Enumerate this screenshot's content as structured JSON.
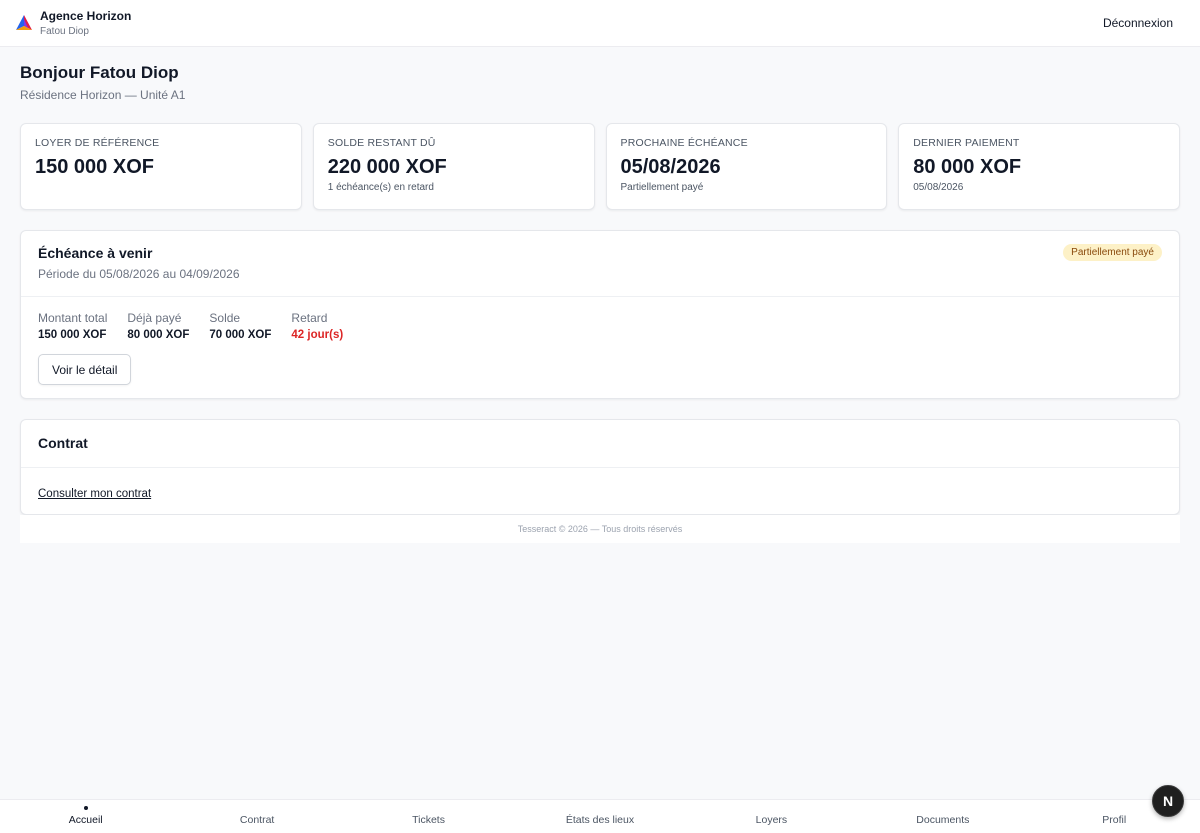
{
  "header": {
    "brand_name": "Agence Horizon",
    "user_name": "Fatou Diop",
    "logout_label": "Déconnexion"
  },
  "greeting": {
    "title": "Bonjour Fatou Diop",
    "residence": "Résidence Horizon — Unité A1"
  },
  "stats": [
    {
      "label": "LOYER DE RÉFÉRENCE",
      "value": "150 000 XOF",
      "sub": ""
    },
    {
      "label": "SOLDE RESTANT DÛ",
      "value": "220 000 XOF",
      "sub": "1 échéance(s) en retard"
    },
    {
      "label": "PROCHAINE ÉCHÉANCE",
      "value": "05/08/2026",
      "sub": "Partiellement payé"
    },
    {
      "label": "DERNIER PAIEMENT",
      "value": "80 000 XOF",
      "sub": "05/08/2026"
    }
  ],
  "due": {
    "title": "Échéance à venir",
    "period": "Période du 05/08/2026 au 04/09/2026",
    "status_badge": "Partiellement payé",
    "amounts": [
      {
        "label": "Montant total",
        "value": "150 000 XOF"
      },
      {
        "label": "Déjà payé",
        "value": "80 000 XOF"
      },
      {
        "label": "Solde",
        "value": "70 000 XOF"
      },
      {
        "label": "Retard",
        "value": "42 jour(s)"
      }
    ],
    "detail_button": "Voir le détail"
  },
  "contract": {
    "title": "Contrat",
    "link_label": "Consulter mon contrat"
  },
  "footer": {
    "text": "Tesseract © 2026 — Tous droits réservés"
  },
  "bottom_nav": {
    "items": [
      {
        "label": "Accueil"
      },
      {
        "label": "Contrat"
      },
      {
        "label": "Tickets"
      },
      {
        "label": "États des lieux"
      },
      {
        "label": "Loyers"
      },
      {
        "label": "Documents"
      },
      {
        "label": "Profil"
      }
    ],
    "active_index": 0
  },
  "dev_badge": {
    "letter": "N"
  },
  "colors": {
    "late_text": "#dc2626",
    "badge_bg": "#fdf1c7",
    "badge_text": "#8a4a0c",
    "page_bg": "#f8f9fb"
  },
  "icons": {
    "brand_logo": "agency-logo-icon"
  }
}
